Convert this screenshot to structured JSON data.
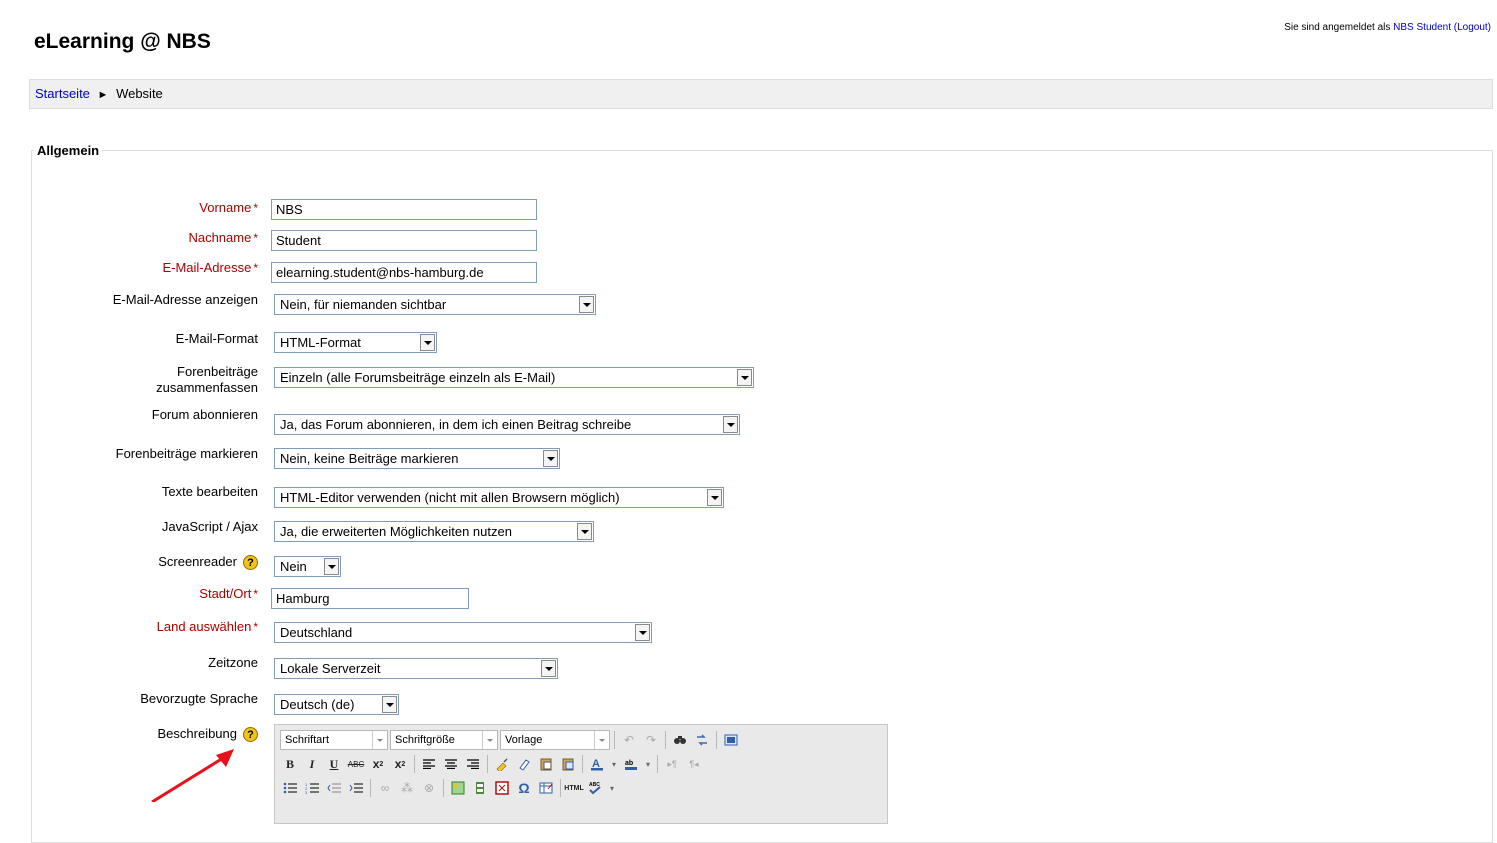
{
  "header": {
    "site_title": "eLearning @ NBS",
    "login_prefix": "Sie sind angemeldet als",
    "user_name": "NBS Student",
    "logout_label": "(Logout)"
  },
  "breadcrumb": {
    "home": "Startseite",
    "separator": "►",
    "current": "Website"
  },
  "form": {
    "legend": "Allgemein",
    "firstname": {
      "label": "Vorname",
      "value": "NBS"
    },
    "lastname": {
      "label": "Nachname",
      "value": "Student"
    },
    "email": {
      "label": "E-Mail-Adresse",
      "value": "elearning.student@nbs-hamburg.de"
    },
    "maildisplay": {
      "label": "E-Mail-Adresse anzeigen",
      "value": "Nein, für niemanden sichtbar"
    },
    "mailformat": {
      "label": "E-Mail-Format",
      "value": "HTML-Format"
    },
    "maildigest": {
      "label_line1": "Forenbeiträge",
      "label_line2": "zusammenfassen",
      "value": "Einzeln (alle Forumsbeiträge einzeln als E-Mail)"
    },
    "autosubscribe": {
      "label": "Forum abonnieren",
      "value": "Ja, das Forum abonnieren, in dem ich einen Beitrag schreibe"
    },
    "trackforums": {
      "label": "Forenbeiträge markieren",
      "value": "Nein, keine Beiträge markieren"
    },
    "htmleditor": {
      "label": "Texte bearbeiten",
      "value": "HTML-Editor verwenden (nicht mit allen Browsern möglich)"
    },
    "ajax": {
      "label": "JavaScript / Ajax",
      "value": "Ja, die erweiterten Möglichkeiten nutzen"
    },
    "screenreader": {
      "label": "Screenreader",
      "value": "Nein"
    },
    "city": {
      "label": "Stadt/Ort",
      "value": "Hamburg"
    },
    "country": {
      "label": "Land auswählen",
      "value": "Deutschland"
    },
    "timezone": {
      "label": "Zeitzone",
      "value": "Lokale Serverzeit"
    },
    "lang": {
      "label": "Bevorzugte Sprache",
      "value": "Deutsch (de)"
    },
    "description": {
      "label": "Beschreibung"
    },
    "required_mark": "*",
    "help_glyph": "?"
  },
  "editor": {
    "font_select": "Schriftart",
    "size_select": "Schriftgröße",
    "format_select": "Vorlage"
  },
  "colors": {
    "required": "#aa0000",
    "link": "#0000cc",
    "annotation_arrow": "#e8101a"
  }
}
